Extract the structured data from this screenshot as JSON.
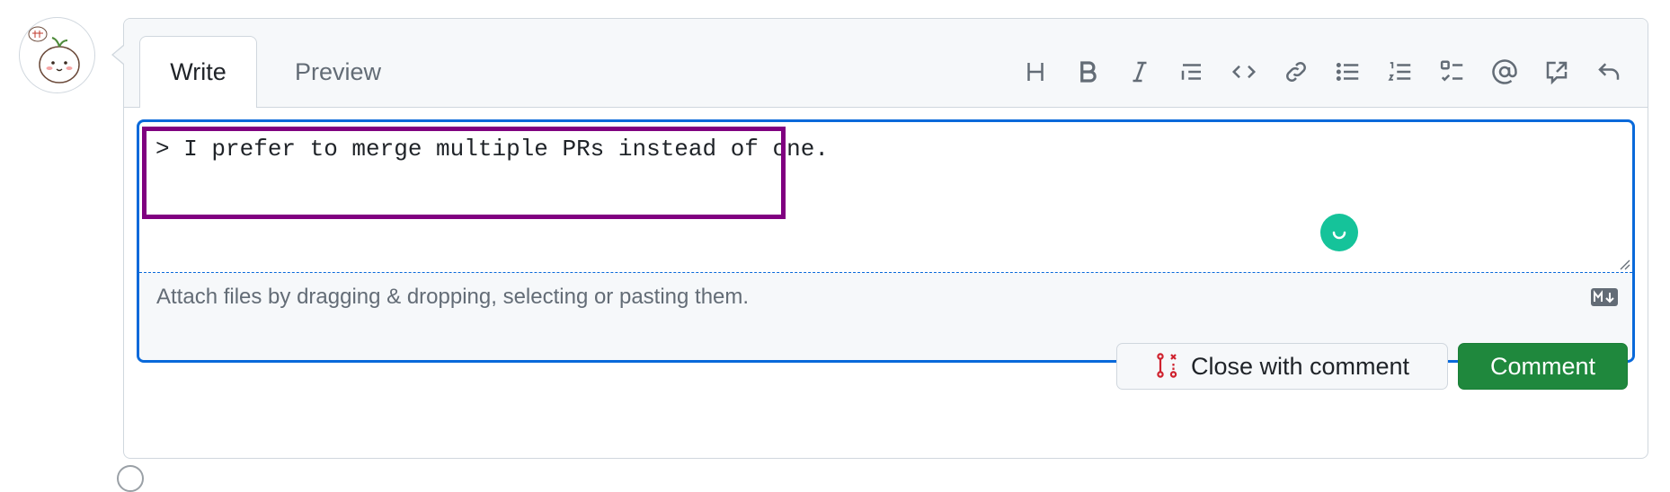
{
  "tabs": {
    "write": "Write",
    "preview": "Preview"
  },
  "toolbar": {
    "icons": [
      "heading-icon",
      "bold-icon",
      "italic-icon",
      "quote-icon",
      "code-icon",
      "link-icon",
      "unordered-list-icon",
      "ordered-list-icon",
      "task-list-icon",
      "mention-icon",
      "cross-reference-icon",
      "reply-icon"
    ]
  },
  "editor": {
    "value": "> I prefer to merge multiple PRs instead of one.",
    "attach_hint": "Attach files by dragging & dropping, selecting or pasting them."
  },
  "buttons": {
    "close_with_comment": "Close with comment",
    "comment": "Comment"
  },
  "colors": {
    "accent_blue": "#0969da",
    "highlight_purple": "#800080",
    "comment_green": "#1f883d",
    "close_icon_red": "#cf222e",
    "grammarly_green": "#15c39a"
  }
}
